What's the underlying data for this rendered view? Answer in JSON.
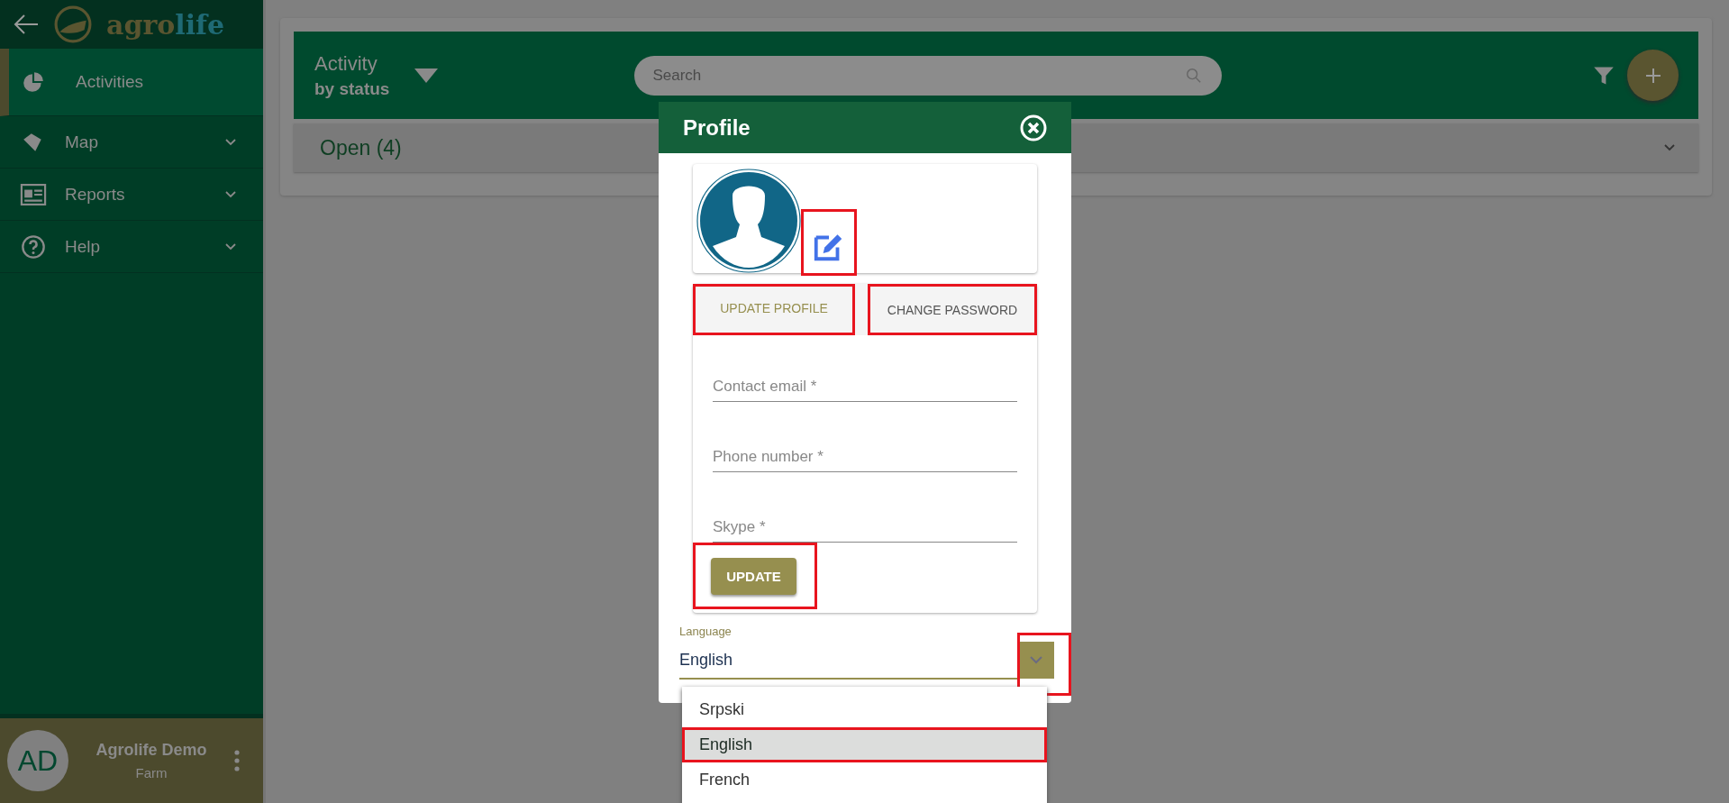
{
  "sidebar": {
    "logo": {
      "part_1": "agro",
      "part_2": "life"
    },
    "items": [
      {
        "label": "Activities",
        "selected": true,
        "expandable": false,
        "kind": "pie"
      },
      {
        "label": "Map",
        "selected": false,
        "expandable": true,
        "kind": "map"
      },
      {
        "label": "Reports",
        "selected": false,
        "expandable": true,
        "kind": "reports"
      },
      {
        "label": "Help",
        "selected": false,
        "expandable": true,
        "kind": "help"
      }
    ],
    "user": {
      "initials": "AD",
      "name": "Agrolife Demo",
      "role": "Farm"
    }
  },
  "header": {
    "title": "Activity",
    "subtitle": "by status",
    "search": {
      "placeholder": "Search"
    }
  },
  "groups": [
    {
      "label": "Open (4)"
    }
  ],
  "dialog": {
    "title": "Profile",
    "edit_highlighted": true,
    "tabs": [
      {
        "label": "UPDATE PROFILE",
        "selected": true,
        "highlighted": true
      },
      {
        "label": "CHANGE PASSWORD",
        "selected": false,
        "highlighted": true
      }
    ],
    "fields": [
      {
        "placeholder": "Contact email *"
      },
      {
        "placeholder": "Phone number *"
      },
      {
        "placeholder": "Skype *"
      }
    ],
    "update_button": {
      "label": "UPDATE",
      "highlighted": true
    },
    "language": {
      "label": "Language",
      "value": "English",
      "toggle_highlighted": true,
      "options": [
        {
          "label": "Srpski",
          "selected": false,
          "highlighted": false
        },
        {
          "label": "English",
          "selected": true,
          "highlighted": true
        },
        {
          "label": "French",
          "selected": false,
          "highlighted": false
        }
      ]
    }
  }
}
